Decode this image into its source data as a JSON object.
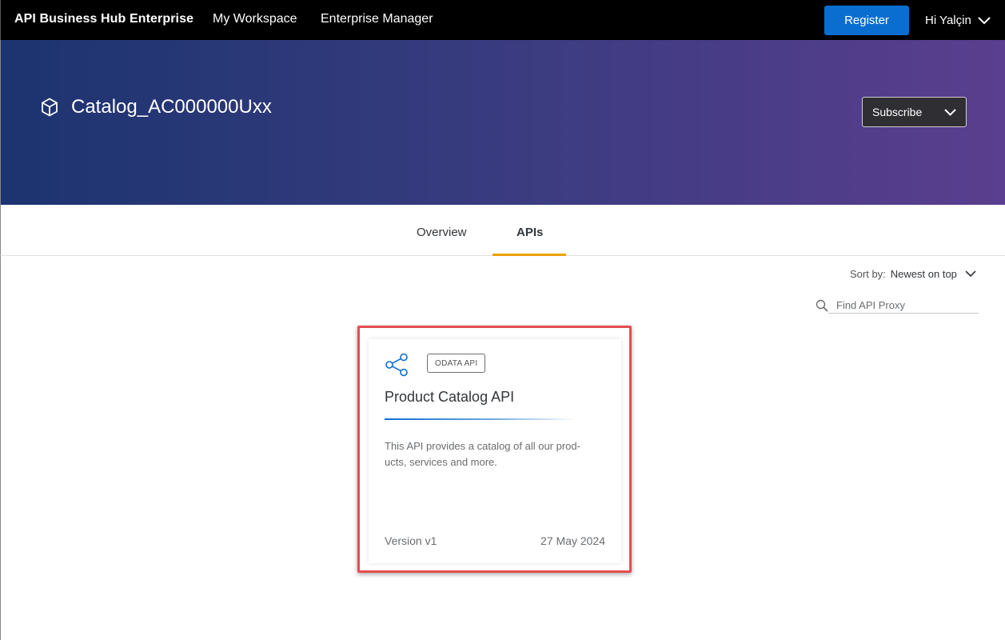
{
  "topbar": {
    "brand": "API Business Hub Enterprise",
    "links": [
      "My Workspace",
      "Enterprise Manager"
    ],
    "register_label": "Register",
    "user_greeting": "Hi Yalçin"
  },
  "hero": {
    "title": "Catalog_AC000000Uxx",
    "subscribe_label": "Subscribe"
  },
  "tabs": [
    {
      "label": "Overview",
      "active": false
    },
    {
      "label": "APIs",
      "active": true
    }
  ],
  "toolbar": {
    "sort_label": "Sort by:",
    "sort_value": "Newest on top",
    "search_placeholder": "Find API Proxy"
  },
  "api_card": {
    "badge": "ODATA API",
    "title": "Product Catalog API",
    "description": "This API provides a catalog of all our prod-ucts, services and more.",
    "description_lines": [
      "This API provides a catalog of all our prod-",
      "ucts, services and more."
    ],
    "version": "Version v1",
    "date": "27 May 2024",
    "icon": "share-network-icon"
  },
  "colors": {
    "topbar": "#000000",
    "register": "#0a6ed1",
    "tab_underline": "#e9a200",
    "highlight": "#e34e4f",
    "hero_start": "#1c3470",
    "hero_end": "#5b3e8f"
  }
}
